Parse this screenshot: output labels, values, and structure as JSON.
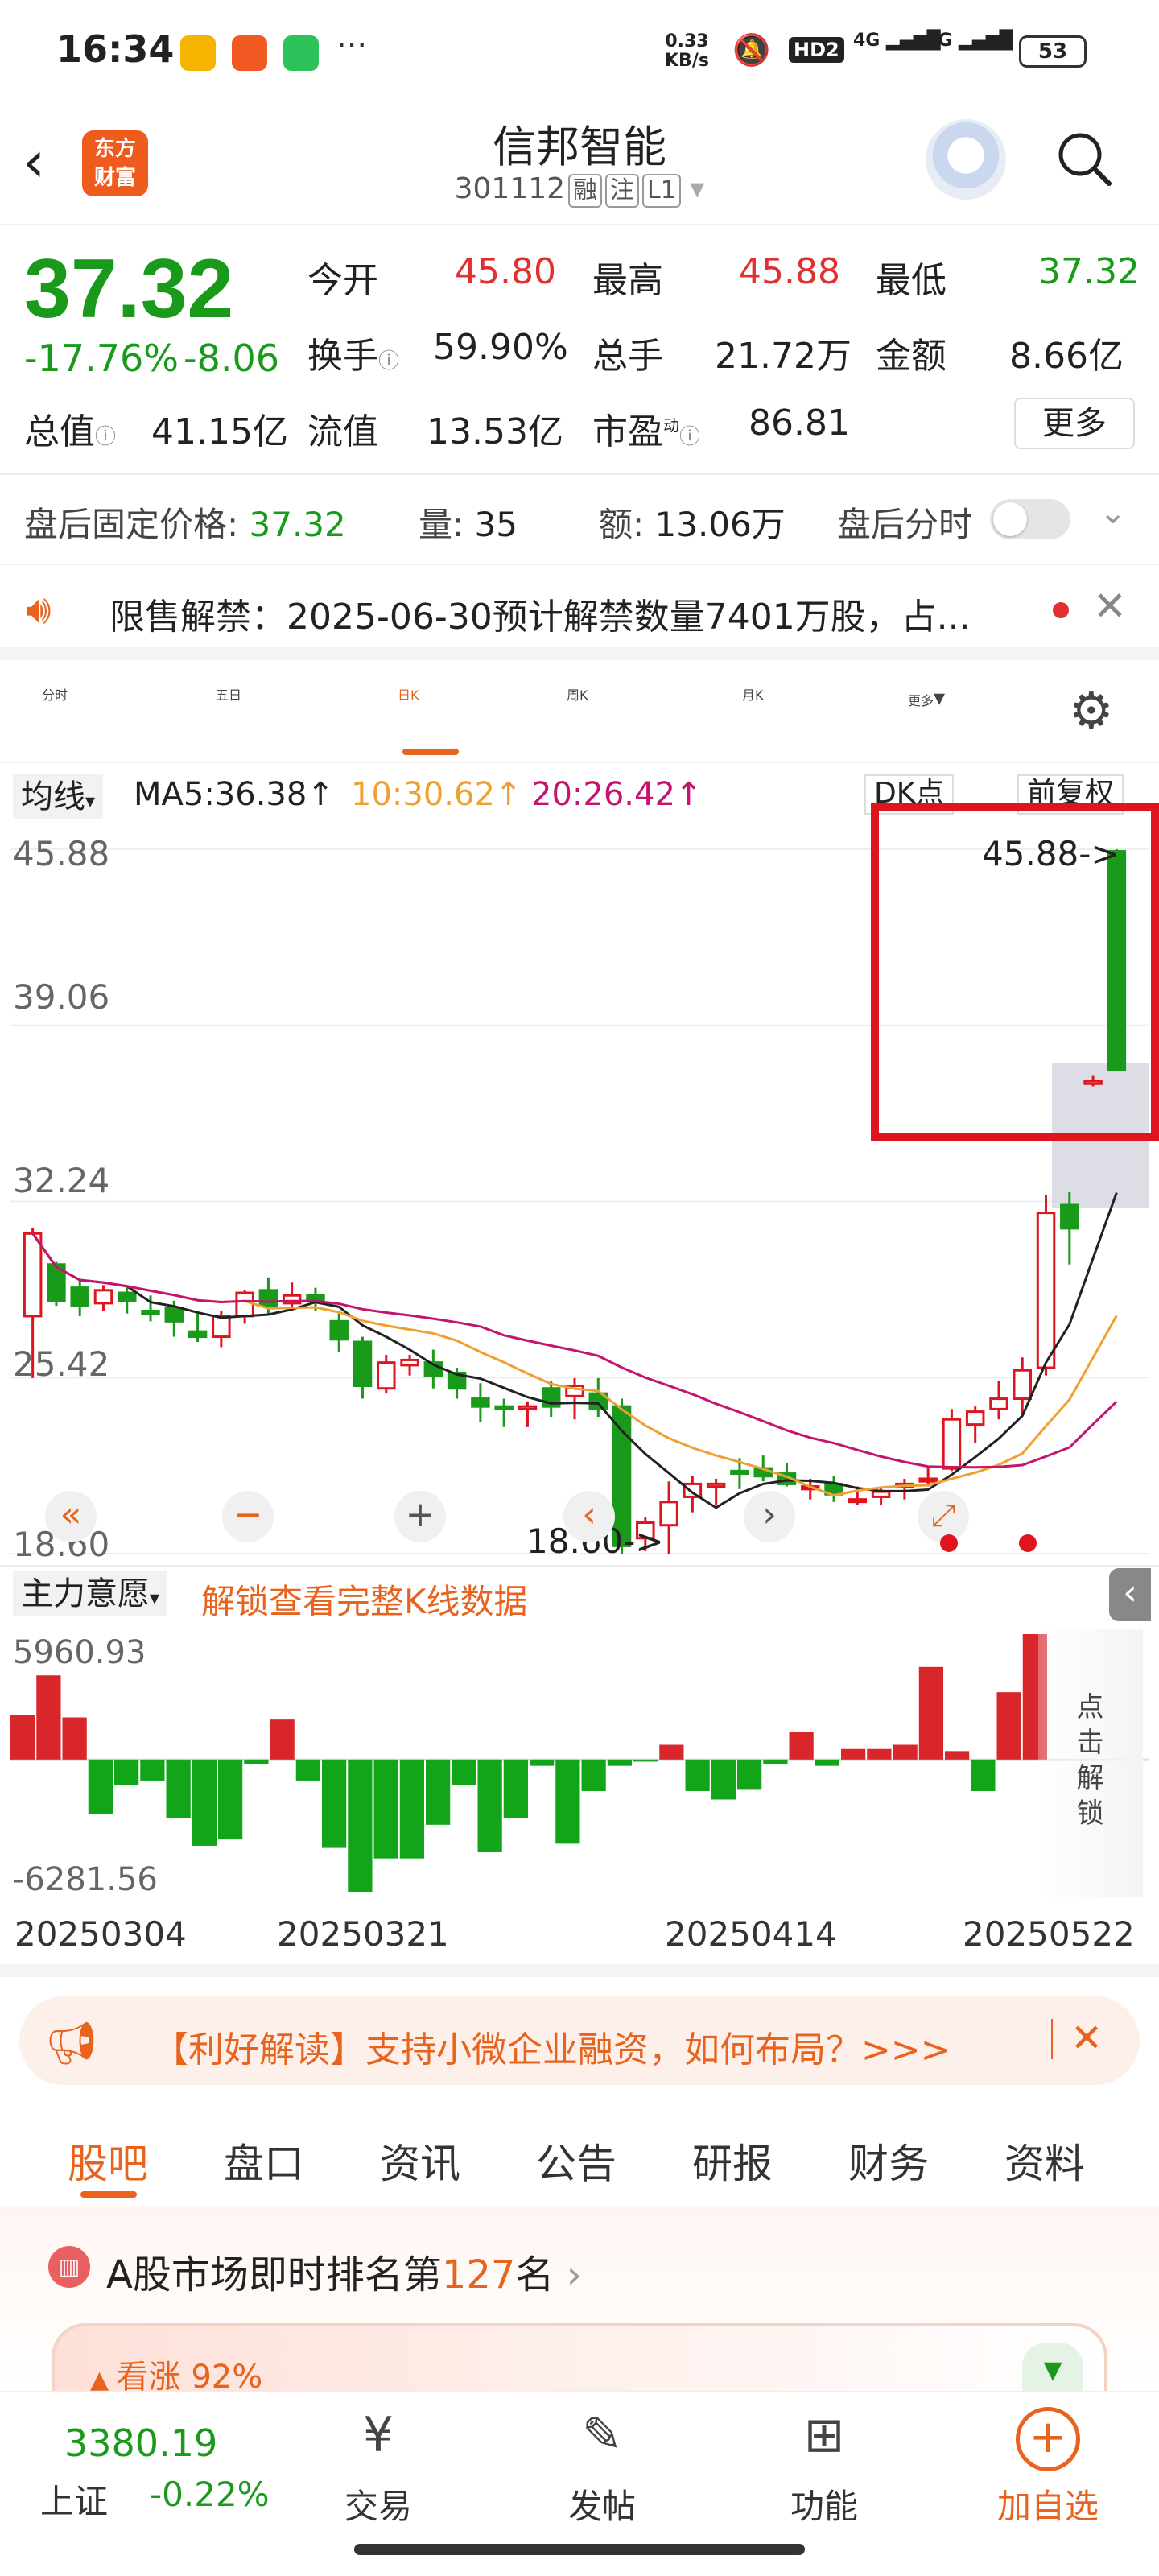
{
  "status": {
    "time": "16:34",
    "net_speed": "0.33",
    "net_unit": "KB/s",
    "hd": "HD2",
    "sig4": "4G",
    "sig5": "5G",
    "battery": "53"
  },
  "header": {
    "stock_name": "信邦智能",
    "stock_code": "301112",
    "tags": [
      "融",
      "注",
      "L1"
    ],
    "logo_line1": "东方",
    "logo_line2": "财富"
  },
  "quote": {
    "price": "37.32",
    "change_pct": "-17.76%",
    "change": "-8.06",
    "open_label": "今开",
    "open": "45.80",
    "high_label": "最高",
    "high": "45.88",
    "low_label": "最低",
    "low": "37.32",
    "turnover_label": "换手",
    "turnover": "59.90%",
    "volume_label": "总手",
    "volume": "21.72万",
    "amount_label": "金额",
    "amount": "8.66亿",
    "mcap_label": "总值",
    "mcap": "41.15亿",
    "float_label": "流值",
    "float_val": "13.53亿",
    "pe_label": "市盈",
    "pe_sup": "动",
    "pe": "86.81",
    "more": "更多"
  },
  "after_hours": {
    "label": "盘后固定价格:",
    "price": "37.32",
    "vol_label": "量:",
    "vol": "35",
    "amt_label": "额:",
    "amt": "13.06万",
    "toggle_label": "盘后分时"
  },
  "notice": {
    "text": "限售解禁：2025-06-30预计解禁数量7401万股，占..."
  },
  "tabs": [
    "分时",
    "五日",
    "日K",
    "周K",
    "月K",
    "更多"
  ],
  "ma": {
    "selector": "均线",
    "ma5": "MA5:36.38↑",
    "ma10": "10:30.62↑",
    "ma20": "20:26.42↑",
    "dk": "DK点",
    "adjust": "前复权"
  },
  "chart_data": {
    "type": "candlestick",
    "y_ticks": [
      "45.88",
      "39.06",
      "32.24",
      "25.42",
      "18.60"
    ],
    "ylim": [
      18.6,
      45.88
    ],
    "max_label": "45.88->",
    "min_label": "18.60->",
    "ohlc": [
      [
        27.8,
        31.2,
        25.4,
        31.0
      ],
      [
        29.8,
        29.9,
        28.2,
        28.4
      ],
      [
        28.9,
        29.2,
        27.8,
        28.2
      ],
      [
        28.3,
        29.0,
        28.0,
        28.8
      ],
      [
        28.7,
        29.0,
        27.9,
        28.4
      ],
      [
        28.0,
        28.6,
        27.6,
        27.9
      ],
      [
        28.1,
        28.4,
        27.0,
        27.6
      ],
      [
        27.2,
        27.9,
        26.8,
        27.0
      ],
      [
        27.0,
        28.0,
        26.6,
        27.8
      ],
      [
        27.8,
        28.8,
        27.5,
        28.7
      ],
      [
        28.8,
        29.3,
        27.9,
        28.2
      ],
      [
        28.3,
        29.1,
        28.0,
        28.6
      ],
      [
        28.6,
        28.9,
        28.0,
        28.4
      ],
      [
        27.6,
        27.9,
        26.4,
        26.9
      ],
      [
        26.8,
        27.0,
        24.6,
        25.1
      ],
      [
        25.0,
        26.3,
        24.8,
        26.0
      ],
      [
        25.9,
        26.3,
        25.5,
        26.1
      ],
      [
        26.0,
        26.5,
        25.0,
        25.5
      ],
      [
        25.6,
        25.8,
        24.6,
        25.0
      ],
      [
        24.6,
        25.2,
        23.7,
        24.3
      ],
      [
        24.3,
        24.6,
        23.5,
        24.2
      ],
      [
        24.2,
        24.5,
        23.5,
        24.3
      ],
      [
        25.0,
        25.3,
        23.9,
        24.3
      ],
      [
        24.7,
        25.4,
        23.8,
        25.1
      ],
      [
        24.8,
        25.4,
        23.9,
        24.2
      ],
      [
        24.3,
        24.6,
        18.6,
        18.9
      ],
      [
        19.2,
        20.0,
        18.7,
        19.8
      ],
      [
        19.7,
        21.4,
        18.6,
        20.6
      ],
      [
        20.8,
        21.6,
        20.2,
        21.3
      ],
      [
        21.2,
        21.5,
        20.5,
        21.3
      ],
      [
        21.8,
        22.3,
        21.1,
        21.7
      ],
      [
        21.9,
        22.4,
        21.4,
        21.6
      ],
      [
        21.7,
        22.1,
        21.2,
        21.3
      ],
      [
        21.1,
        21.5,
        20.7,
        21.2
      ],
      [
        21.3,
        21.6,
        20.6,
        20.9
      ],
      [
        20.7,
        21.2,
        20.5,
        20.7
      ],
      [
        20.8,
        21.2,
        20.5,
        21.0
      ],
      [
        21.2,
        21.5,
        20.7,
        21.3
      ],
      [
        21.4,
        22.0,
        21.2,
        21.5
      ],
      [
        21.9,
        24.2,
        21.8,
        23.8
      ],
      [
        23.6,
        24.3,
        22.9,
        24.1
      ],
      [
        24.2,
        25.3,
        23.8,
        24.6
      ],
      [
        24.6,
        26.2,
        24.0,
        25.7
      ],
      [
        25.8,
        32.5,
        25.5,
        31.8
      ],
      [
        32.1,
        32.6,
        29.8,
        31.2
      ],
      [
        36.8,
        37.1,
        36.7,
        36.9
      ],
      [
        45.8,
        45.88,
        37.32,
        37.32
      ]
    ],
    "ma_lines": {
      "ma5": "#222222",
      "ma10": "#f0a030",
      "ma20": "#c41470"
    }
  },
  "sub_header": {
    "selector": "主力意愿",
    "unlock": "解锁查看完整K线数据"
  },
  "volume_chart": {
    "max": "5960.93",
    "min": "-6281.56",
    "values": [
      2100,
      4000,
      2000,
      -2600,
      -1200,
      -1000,
      -2800,
      -4100,
      -3800,
      -200,
      1900,
      -1000,
      -4200,
      -6281,
      -4700,
      -4700,
      -3100,
      -1200,
      -4400,
      -2800,
      -300,
      -4000,
      -1500,
      -300,
      -100,
      700,
      -1500,
      -1900,
      -1400,
      -200,
      1300,
      -300,
      500,
      500,
      700,
      4400,
      400,
      -1500,
      3200,
      5960
    ],
    "unlock_side": "点击解锁"
  },
  "dates": [
    "20250304",
    "20250321",
    "20250414",
    "20250522"
  ],
  "promo": {
    "text": "【利好解读】支持小微企业融资，如何布局？>>>"
  },
  "bottom_tabs": [
    "股吧",
    "盘口",
    "资讯",
    "公告",
    "研报",
    "财务",
    "资料"
  ],
  "rank": {
    "text_pre": "A股市场即时排名第",
    "num": "127",
    "text_post": "名",
    "bull": "看涨 92%"
  },
  "bottom_nav": {
    "index_val": "3380.19",
    "index_name": "上证",
    "index_chg": "-0.22%",
    "items": [
      "交易",
      "发帖",
      "功能",
      "加自选"
    ]
  }
}
